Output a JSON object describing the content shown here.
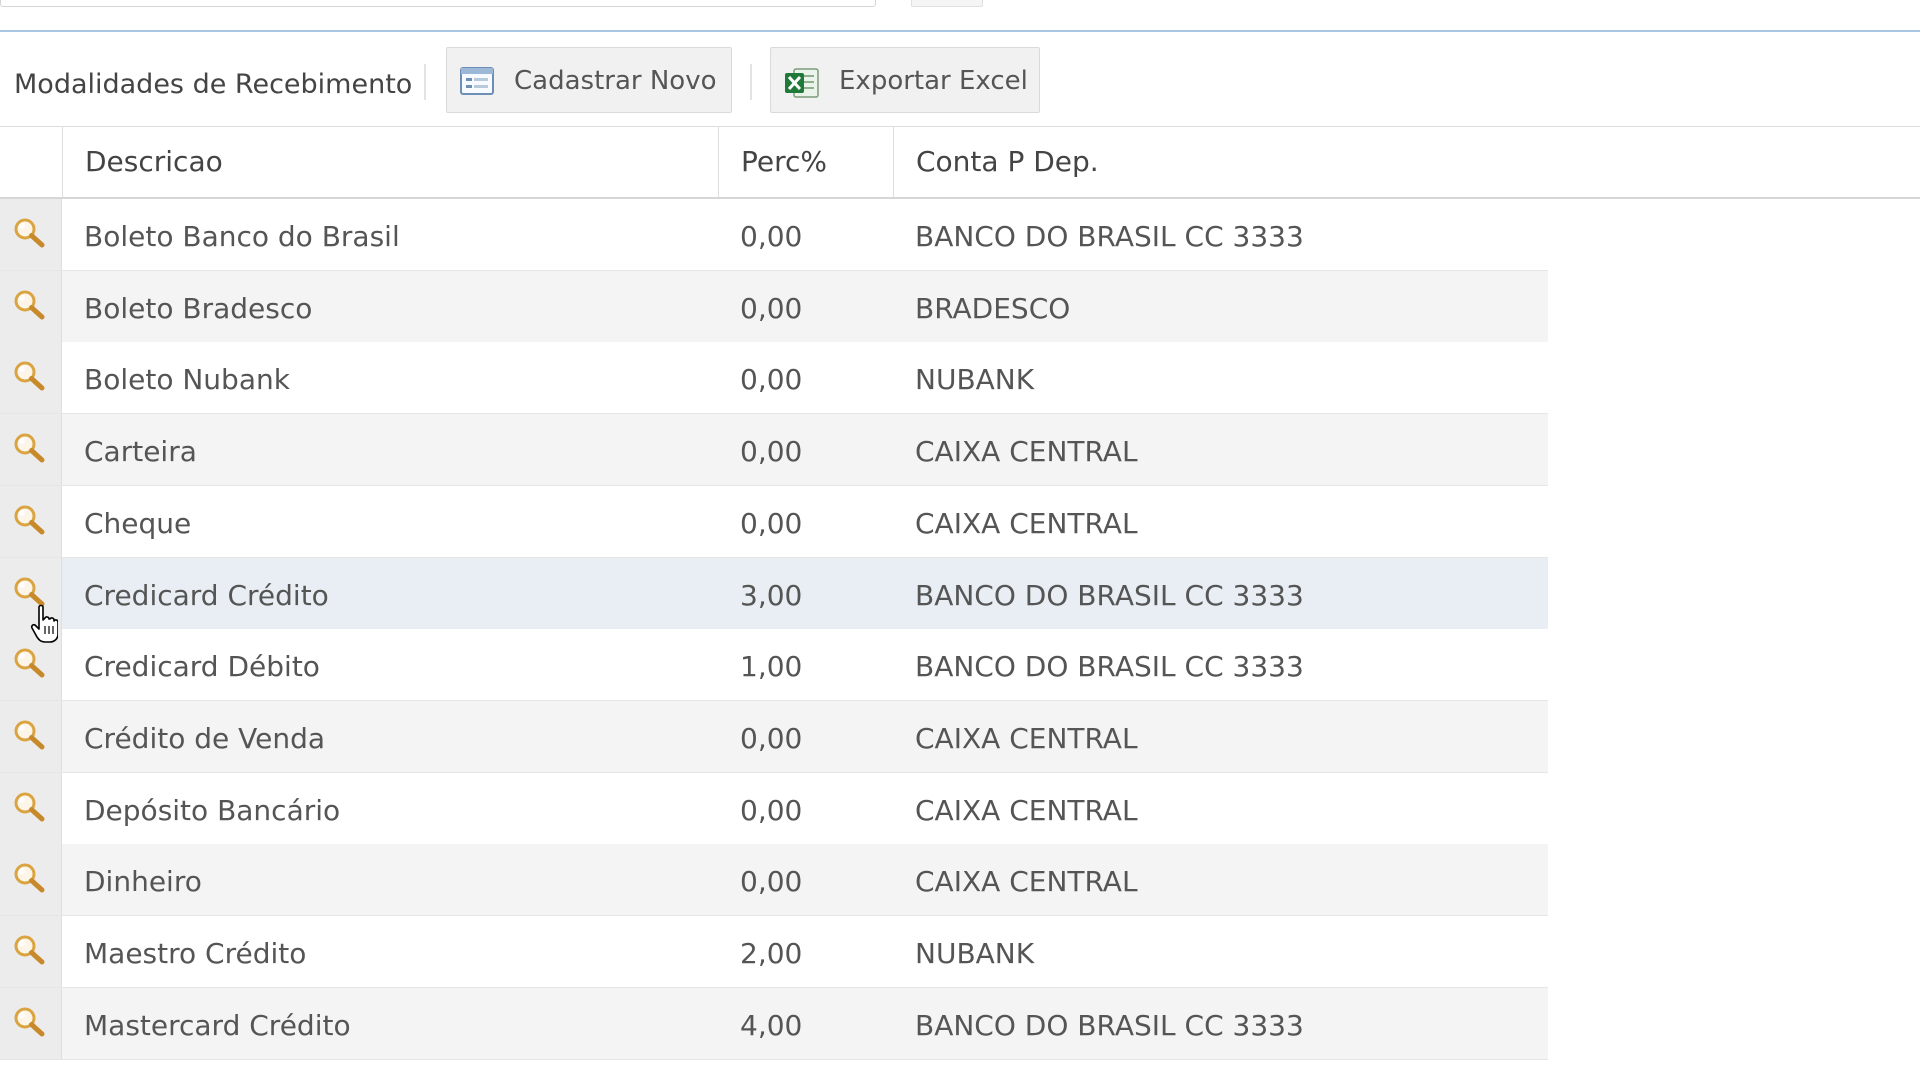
{
  "toolbar": {
    "title": "Modalidades de Recebimento",
    "new_button_label": "Cadastrar Novo",
    "export_button_label": "Exportar Excel",
    "new_button_icon": "form-icon",
    "export_button_icon": "excel-icon"
  },
  "table": {
    "columns": [
      "Descricao",
      "Perc%",
      "Conta P Dep."
    ],
    "row_icon": "magnifier-icon",
    "rows": [
      {
        "descricao": "Boleto Banco do Brasil",
        "perc": "0,00",
        "conta": "BANCO DO BRASIL CC 3333"
      },
      {
        "descricao": "Boleto Bradesco",
        "perc": "0,00",
        "conta": "BRADESCO"
      },
      {
        "descricao": "Boleto Nubank",
        "perc": "0,00",
        "conta": "NUBANK"
      },
      {
        "descricao": "Carteira",
        "perc": "0,00",
        "conta": "CAIXA CENTRAL"
      },
      {
        "descricao": "Cheque",
        "perc": "0,00",
        "conta": "CAIXA CENTRAL"
      },
      {
        "descricao": "Credicard Crédito",
        "perc": "3,00",
        "conta": "BANCO DO BRASIL CC 3333"
      },
      {
        "descricao": "Credicard Débito",
        "perc": "1,00",
        "conta": "BANCO DO BRASIL CC 3333"
      },
      {
        "descricao": "Crédito de Venda",
        "perc": "0,00",
        "conta": "CAIXA CENTRAL"
      },
      {
        "descricao": "Depósito Bancário",
        "perc": "0,00",
        "conta": "CAIXA CENTRAL"
      },
      {
        "descricao": "Dinheiro",
        "perc": "0,00",
        "conta": "CAIXA CENTRAL"
      },
      {
        "descricao": "Maestro Crédito",
        "perc": "2,00",
        "conta": "NUBANK"
      },
      {
        "descricao": "Mastercard Crédito",
        "perc": "4,00",
        "conta": "BANCO DO BRASIL CC 3333"
      }
    ]
  },
  "colors": {
    "header_rule": "#a9c7e0",
    "row_alt": "#f4f4f4",
    "row_hover": "#e8eef3",
    "icon_accent": "#d9a441"
  }
}
